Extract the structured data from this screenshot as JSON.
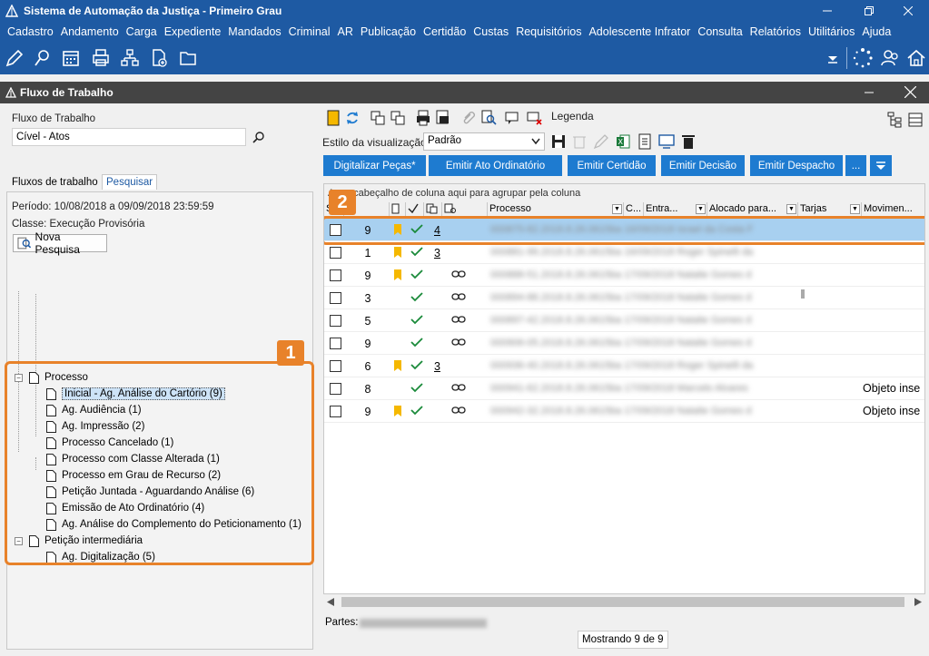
{
  "window": {
    "title": "Sistema de Automação da Justiça - Primeiro Grau"
  },
  "menu": [
    "Cadastro",
    "Andamento",
    "Carga",
    "Expediente",
    "Mandados",
    "Criminal",
    "AR",
    "Publicação",
    "Certidão",
    "Custas",
    "Requisitórios",
    "Adolescente Infrator",
    "Consulta",
    "Relatórios",
    "Utilitários",
    "Ajuda"
  ],
  "subwindow": {
    "title": "Fluxo de Trabalho"
  },
  "left": {
    "fluxo_label": "Fluxo de Trabalho",
    "fluxo_value": "Cível - Atos",
    "tabs": [
      "Fluxos de trabalho",
      "Pesquisar"
    ],
    "periodo": "Período: 10/08/2018 a 09/09/2018 23:59:59",
    "classe": "Classe: Execução Provisória",
    "nova_pesquisa": "Nova Pesquisa",
    "tree": {
      "group1": "Processo",
      "items1": [
        "Inicial - Ag. Análise do Cartório (9)",
        "Ag. Audiência (1)",
        "Ag. Impressão (2)",
        "Processo Cancelado (1)",
        "Processo com Classe Alterada (1)",
        "Processo em Grau de Recurso (2)",
        "Petição Juntada - Aguardando Análise (6)",
        "Emissão de Ato Ordinatório (4)",
        "Ag. Análise do Complemento do Peticionamento (1)"
      ],
      "group2": "Petição intermediária",
      "items2": [
        "Ag. Digitalização (5)"
      ]
    },
    "badge": "1"
  },
  "right": {
    "legenda": "Legenda",
    "estilo_label": "Estilo da visualização",
    "estilo_value": "Padrão",
    "actions": [
      "Digitalizar Peças*",
      "Emitir Ato Ordinatório",
      "Emitir Certidão",
      "Emitir Decisão",
      "Emitir Despacho",
      "..."
    ],
    "group_hint": "A      um cabeçalho de coluna aqui para agrupar pela coluna",
    "headers": [
      "S",
      "",
      "",
      "",
      "",
      "Processo",
      "C...",
      "Entra...",
      "Alocado para...",
      "Tarjas",
      "Movimen..."
    ],
    "rows": [
      {
        "num": "9",
        "flag": true,
        "check": true,
        "count": "4",
        "link": false,
        "blur": "000875-82.2018.8.26.0615ba 16/09/2018 Israel da Costa F",
        "mov": ""
      },
      {
        "num": "1",
        "flag": true,
        "check": true,
        "count": "3",
        "link": false,
        "blur": "000881-99.2018.8.26.0615ba 16/09/2018 Roger Spinelli da",
        "mov": ""
      },
      {
        "num": "9",
        "flag": true,
        "check": true,
        "count": "",
        "link": true,
        "blur": "000888-51.2018.8.26.0615ba 17/09/2018 Natalie Gomes d",
        "mov": ""
      },
      {
        "num": "3",
        "flag": false,
        "check": true,
        "count": "",
        "link": true,
        "blur": "000894-88.2018.8.26.0615ba 17/09/2018 Natalie Gomes d",
        "mov": ""
      },
      {
        "num": "5",
        "flag": false,
        "check": true,
        "count": "",
        "link": true,
        "blur": "000897-42.2018.8.26.0615ba 17/09/2018 Natalie Gomes d",
        "mov": ""
      },
      {
        "num": "9",
        "flag": false,
        "check": true,
        "count": "",
        "link": true,
        "blur": "000906-05.2018.8.26.0615ba 17/09/2018 Natalie Gomes d",
        "mov": ""
      },
      {
        "num": "6",
        "flag": true,
        "check": true,
        "count": "3",
        "link": false,
        "blur": "000936-40.2018.8.26.0615ba 17/09/2018 Roger Spinelli da",
        "mov": ""
      },
      {
        "num": "8",
        "flag": false,
        "check": true,
        "count": "",
        "link": true,
        "blur": "000941-62.2018.8.26.0615ba 17/09/2018 Marcelo Alvares",
        "mov": "Objeto inse"
      },
      {
        "num": "9",
        "flag": true,
        "check": true,
        "count": "",
        "link": true,
        "blur": "000942-32.2018.8.26.0615ba 17/09/2018 Natalie Gomes d",
        "mov": "Objeto inse"
      }
    ],
    "partes_label": "Partes:",
    "mostrando": "Mostrando 9 de 9",
    "badge": "2"
  },
  "colors": {
    "brand": "#1e5aa3",
    "action": "#1e7bd0",
    "highlight": "#e8822a",
    "flag": "#f5b800",
    "check": "#1a8a3a"
  }
}
